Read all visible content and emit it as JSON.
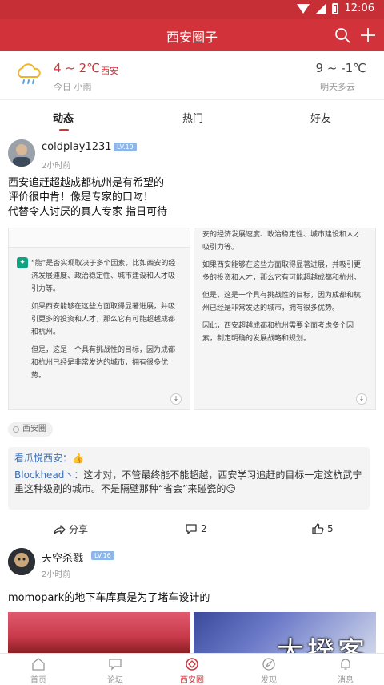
{
  "status_bar": {
    "time": "12:06"
  },
  "header": {
    "title": "西安圈子"
  },
  "weather": {
    "today_temp": "4 ~ 2℃",
    "city": "西安",
    "today_desc": "今日 小雨",
    "tomorrow_temp": "9 ~ -1℃",
    "tomorrow_desc": "明天多云"
  },
  "tabs": [
    {
      "label": "动态",
      "active": true
    },
    {
      "label": "热门",
      "active": false
    },
    {
      "label": "好友",
      "active": false
    }
  ],
  "post1": {
    "username": "coldplay1231",
    "level": "LV.19",
    "time": "2小时前",
    "text": "西安追赶超越成都杭州是有希望的\n评价很中肯！像是专家的口吻！\n代替令人讨厌的真人专家 指日可待",
    "image_left": {
      "p1": "“能”是否实现取决于多个因素，比如西安的经济发展速度、政治稳定性、城市建设和人才吸引力等。",
      "p2": "如果西安能够在这些方面取得显著进展，并吸引更多的投资和人才，那么它有可能超越成都和杭州。",
      "p3": "但是，这是一个具有挑战性的目标，因为成都和杭州已经是非常发达的城市，拥有很多优势。"
    },
    "image_right": {
      "p0": "安的经济发展速度、政治稳定性、城市建设和人才吸引力等。",
      "p1": "如果西安能够在这些方面取得显著进展，并吸引更多的投资和人才，那么它有可能超越成都和杭州。",
      "p2": "但是，这是一个具有挑战性的目标，因为成都和杭州已经是非常发达的城市，拥有很多优势。",
      "p3": "因此，西安超越成都和杭州需要全面考虑多个因素，制定明确的发展战略和规划。"
    },
    "tag": "西安圈",
    "comments": [
      {
        "name": "看瓜悦西安：",
        "text": "👍"
      },
      {
        "name": "Blockhead丶：",
        "text": "这才对，不管最终能不能超越，西安学习追赶的目标一定这杭武宁重这种级别的城市。不是隔壁那种“省会”来碰瓷的😏"
      }
    ],
    "share_label": "分享",
    "comment_count": "2",
    "like_count": "5"
  },
  "post2": {
    "username": "天空杀戮",
    "level": "LV.16",
    "time": "2小时前",
    "text": "momopark的地下车库真是为了堵车设计的"
  },
  "watermark": "大揆客",
  "bottom_nav": [
    {
      "label": "首页",
      "active": false
    },
    {
      "label": "论坛",
      "active": false
    },
    {
      "label": "西安圈",
      "active": true
    },
    {
      "label": "发现",
      "active": false
    },
    {
      "label": "消息",
      "active": false
    }
  ],
  "colors": {
    "brand": "#d23239",
    "link": "#3b6fb6",
    "level_badge": "#8fb6e8"
  }
}
